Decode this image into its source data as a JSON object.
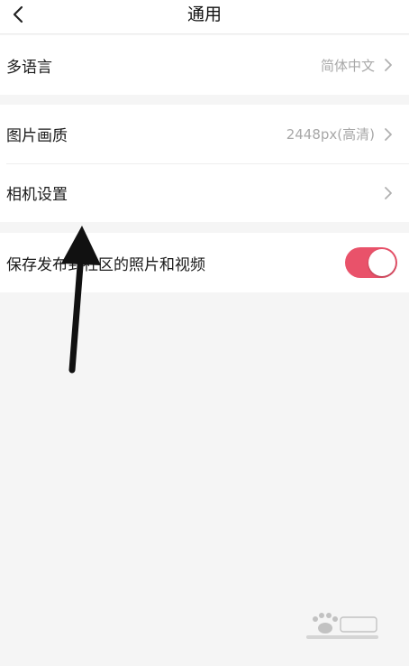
{
  "header": {
    "title": "通用",
    "back_icon": "chevron-left-icon"
  },
  "groups": [
    {
      "rows": [
        {
          "label": "多语言",
          "value": "简体中文",
          "chevron": true
        }
      ]
    },
    {
      "rows": [
        {
          "label": "图片画质",
          "value": "2448px(高清)",
          "chevron": true
        },
        {
          "label": "相机设置",
          "value": "",
          "chevron": true
        }
      ]
    },
    {
      "rows": [
        {
          "label": "保存发布到社区的照片和视频",
          "toggle": true,
          "toggle_on": true
        }
      ]
    }
  ],
  "colors": {
    "accent_toggle": "#e9526a",
    "background": "#f5f5f5",
    "row_background": "#ffffff",
    "text_primary": "#1a1a1a",
    "text_secondary": "#a8a8a8"
  },
  "annotation": {
    "icon": "arrow-up-icon",
    "color": "#111111"
  },
  "watermark": {
    "icon": "baidu-paw-icon"
  }
}
